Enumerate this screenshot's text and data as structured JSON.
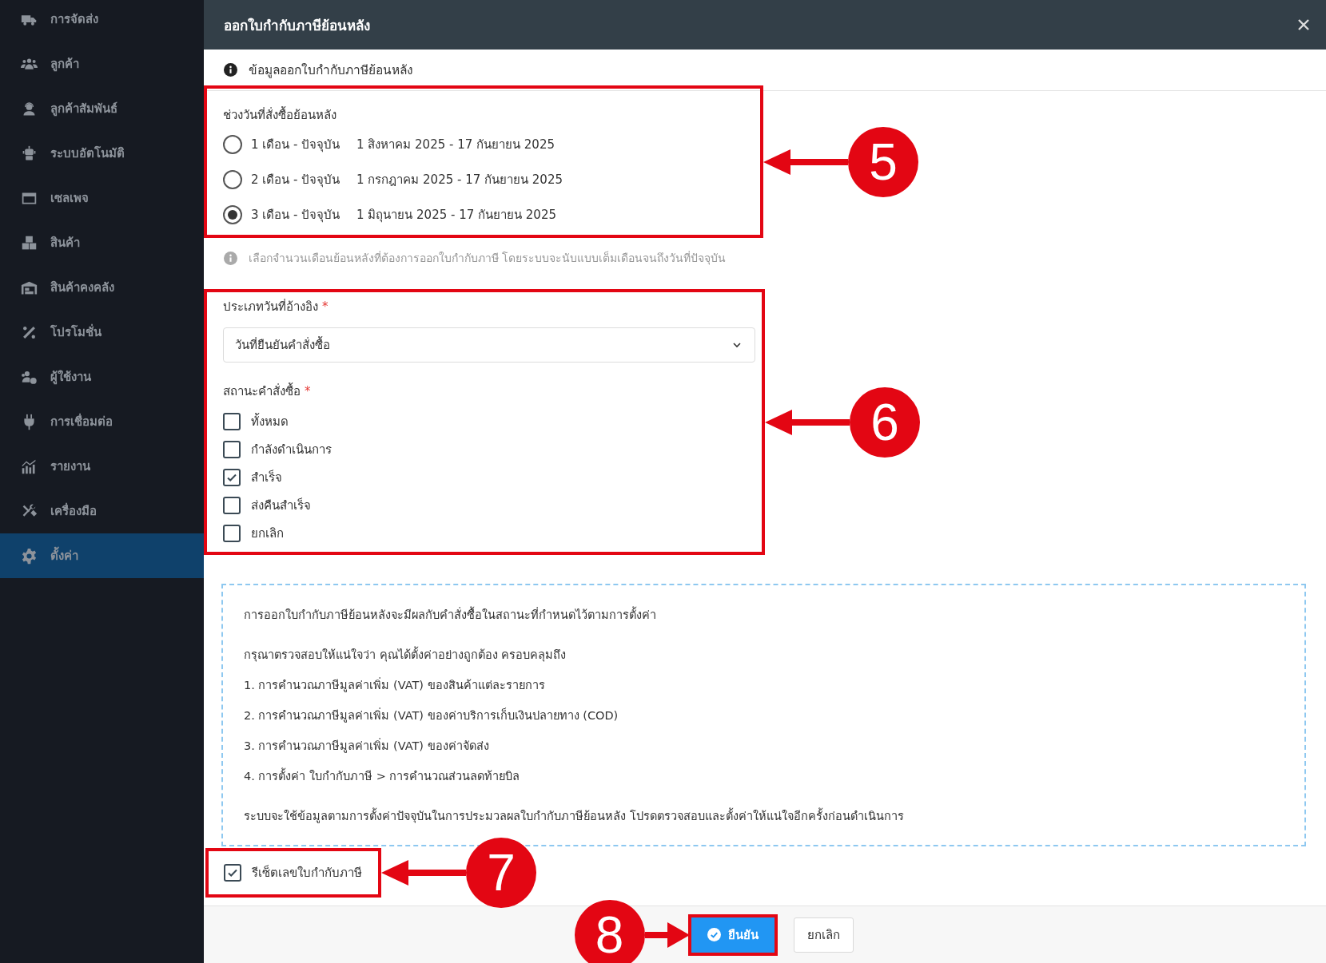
{
  "sidebar": {
    "items": [
      {
        "label": "การจัดส่ง",
        "selected": false
      },
      {
        "label": "ลูกค้า",
        "selected": false
      },
      {
        "label": "ลูกค้าสัมพันธ์",
        "selected": false
      },
      {
        "label": "ระบบอัตโนมัติ",
        "selected": false
      },
      {
        "label": "เซลเพจ",
        "selected": false
      },
      {
        "label": "สินค้า",
        "selected": false
      },
      {
        "label": "สินค้าคงคลัง",
        "selected": false
      },
      {
        "label": "โปรโมชั่น",
        "selected": false
      },
      {
        "label": "ผู้ใช้งาน",
        "selected": false
      },
      {
        "label": "การเชื่อมต่อ",
        "selected": false
      },
      {
        "label": "รายงาน",
        "selected": false
      },
      {
        "label": "เครื่องมือ",
        "selected": false
      },
      {
        "label": "ตั้งค่า",
        "selected": true
      }
    ]
  },
  "modal": {
    "title": "ออกใบกำกับภาษีย้อนหลัง",
    "section_title": "ข้อมูลออกใบกำกับภาษีย้อนหลัง",
    "date_range": {
      "label": "ช่วงวันที่สั่งซื้อย้อนหลัง",
      "callout": "5",
      "options": [
        {
          "label": "1 เดือน - ปัจจุบัน",
          "range": "1 สิงหาคม 2025 - 17 กันยายน 2025",
          "selected": false
        },
        {
          "label": "2 เดือน - ปัจจุบัน",
          "range": "1 กรกฎาคม 2025 - 17 กันยายน 2025",
          "selected": false
        },
        {
          "label": "3 เดือน - ปัจจุบัน",
          "range": "1 มิถุนายน 2025 - 17 กันยายน 2025",
          "selected": true
        }
      ]
    },
    "hint": "เลือกจำนวนเดือนย้อนหลังที่ต้องการออกใบกำกับภาษี โดยระบบจะนับแบบเต็มเดือนจนถึงวันที่ปัจจุบัน",
    "filters": {
      "callout": "6",
      "reference_date": {
        "label": "ประเภทวันที่อ้างอิง",
        "required_mark": "*",
        "value": "วันที่ยืนยันคำสั่งซื้อ"
      },
      "order_status": {
        "label": "สถานะคำสั่งซื้อ",
        "required_mark": "*",
        "options": [
          {
            "label": "ทั้งหมด",
            "checked": false
          },
          {
            "label": "กำลังดำเนินการ",
            "checked": false
          },
          {
            "label": "สำเร็จ",
            "checked": true
          },
          {
            "label": "ส่งคืนสำเร็จ",
            "checked": false
          },
          {
            "label": "ยกเลิก",
            "checked": false
          }
        ]
      }
    },
    "notice": {
      "intro": "การออกใบกำกับภาษีย้อนหลังจะมีผลกับคำสั่งซื้อในสถานะที่กำหนดไว้ตามการตั้งค่า",
      "checklist_title": "กรุณาตรวจสอบให้แน่ใจว่า คุณได้ตั้งค่าอย่างถูกต้อง ครอบคลุมถึง",
      "items": [
        "1. การคำนวณภาษีมูลค่าเพิ่ม (VAT) ของสินค้าแต่ละรายการ",
        "2. การคำนวณภาษีมูลค่าเพิ่ม (VAT) ของค่าบริการเก็บเงินปลายทาง (COD)",
        "3. การคำนวณภาษีมูลค่าเพิ่ม (VAT) ของค่าจัดส่ง",
        "4. การตั้งค่า ใบกำกับภาษี > การคำนวณส่วนลดท้ายบิล"
      ],
      "closing": "ระบบจะใช้ข้อมูลตามการตั้งค่าปัจจุบันในการประมวลผลใบกำกับภาษีย้อนหลัง โปรดตรวจสอบและตั้งค่าให้แน่ใจอีกครั้งก่อนดำเนินการ"
    },
    "reset_numbering": {
      "label": "รีเซ็ตเลขใบกำกับภาษี",
      "checked": true,
      "callout": "7"
    },
    "footer": {
      "confirm": "ยืนยัน",
      "cancel": "ยกเลิก",
      "callout": "8"
    }
  }
}
